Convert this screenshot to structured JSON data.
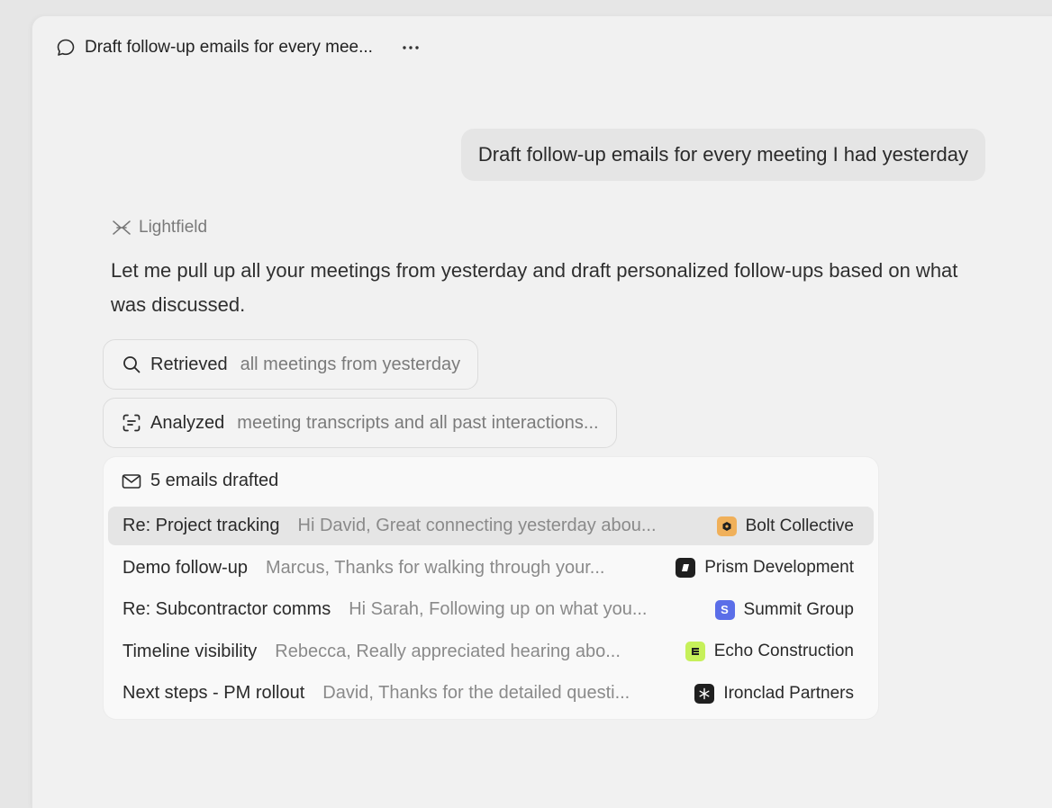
{
  "header": {
    "title": "Draft follow-up emails for every mee...",
    "more_label": "···"
  },
  "user_message": "Draft follow-up emails for every meeting I had yesterday",
  "assistant": {
    "name": "Lightfield",
    "message": "Let me pull up all your meetings from yesterday and draft personalized follow-ups based on what was discussed."
  },
  "tool_steps": [
    {
      "icon": "search-icon",
      "verb": "Retrieved",
      "detail": "all meetings from yesterday"
    },
    {
      "icon": "scan-text-icon",
      "verb": "Analyzed",
      "detail": "meeting transcripts and all past interactions..."
    }
  ],
  "emails": {
    "header": "5 emails drafted",
    "items": [
      {
        "subject": "Re: Project tracking",
        "preview": "Hi David, Great connecting yesterday abou...",
        "company": "Bolt Collective",
        "badge_color": "#f0b05a",
        "active": true
      },
      {
        "subject": "Demo follow-up",
        "preview": "Marcus, Thanks for walking through your...",
        "company": "Prism Development",
        "badge_color": "#1f1f1f",
        "active": false
      },
      {
        "subject": "Re: Subcontractor comms",
        "preview": "Hi Sarah, Following up on what you...",
        "company": "Summit Group",
        "badge_color": "#5b6ee8",
        "badge_letter": "S",
        "active": false
      },
      {
        "subject": "Timeline visibility",
        "preview": "Rebecca, Really appreciated hearing abo...",
        "company": "Echo Construction",
        "badge_color": "#c6f05a",
        "active": false
      },
      {
        "subject": "Next steps - PM rollout",
        "preview": "David, Thanks for the detailed questi...",
        "company": "Ironclad Partners",
        "badge_color": "#1f1f1f",
        "active": false
      }
    ]
  }
}
